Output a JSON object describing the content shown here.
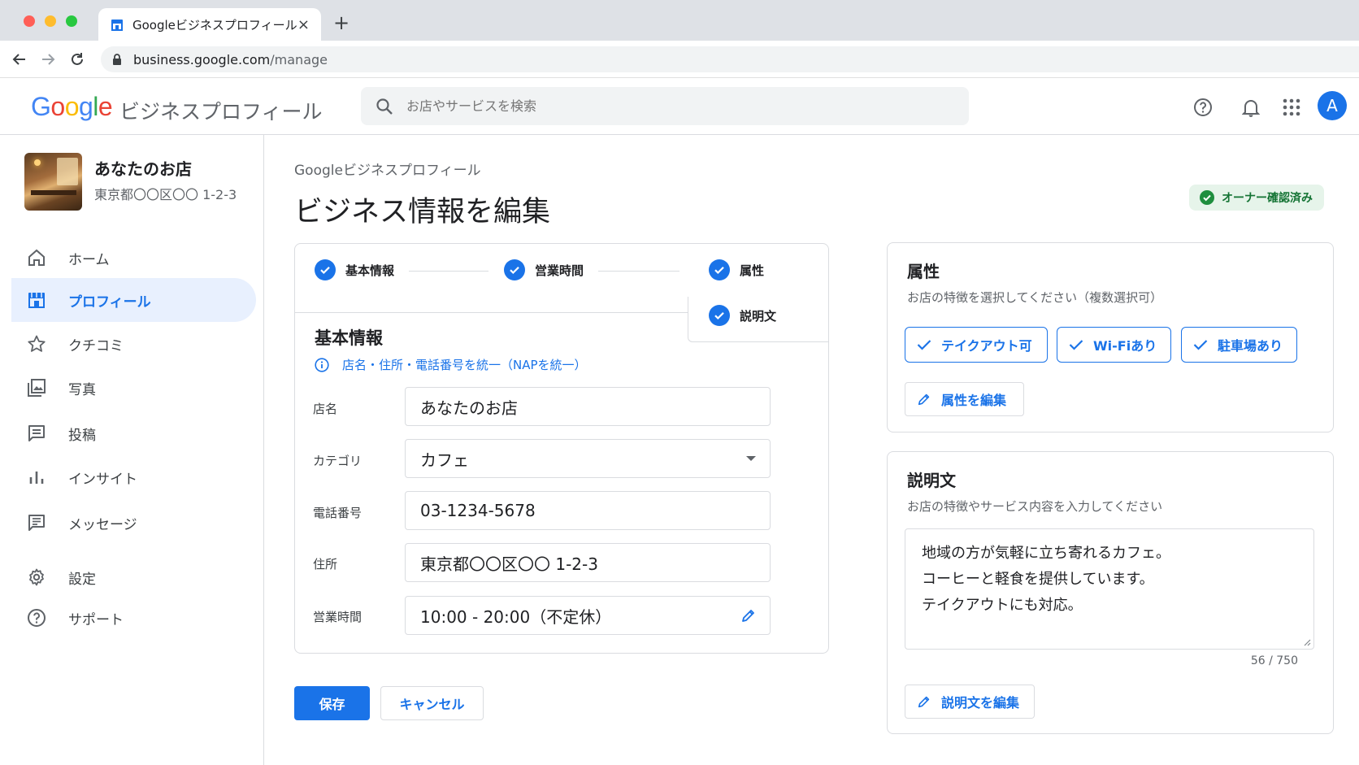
{
  "browser": {
    "tab_title": "Googleビジネスプロフィール",
    "tab_close": "×",
    "new_tab": "+",
    "url_host": "business.google.com",
    "url_path": "/manage"
  },
  "header": {
    "logo": [
      "G",
      "o",
      "o",
      "g",
      "l",
      "e"
    ],
    "product_name": "ビジネスプロフィール",
    "search_placeholder": "お店やサービスを検索",
    "avatar_letter": "A"
  },
  "sidebar": {
    "business_name": "あなたのお店",
    "business_address": "東京都〇〇区〇〇 1-2-3",
    "items": [
      {
        "label": "ホーム",
        "icon": "home-icon"
      },
      {
        "label": "プロフィール",
        "icon": "storefront-icon",
        "active": true
      },
      {
        "label": "クチコミ",
        "icon": "star-icon"
      },
      {
        "label": "写真",
        "icon": "photo-icon"
      },
      {
        "label": "投稿",
        "icon": "post-icon"
      },
      {
        "label": "インサイト",
        "icon": "bar-chart-icon"
      },
      {
        "label": "メッセージ",
        "icon": "message-icon"
      },
      {
        "label": "設定",
        "icon": "gear-icon"
      },
      {
        "label": "サポート",
        "icon": "help-icon"
      }
    ]
  },
  "main": {
    "breadcrumb": "Googleビジネスプロフィール",
    "title": "ビジネス情報を編集",
    "verified_badge": "オーナー確認済み",
    "steps": [
      "基本情報",
      "営業時間",
      "属性",
      "説明文"
    ],
    "basic": {
      "title": "基本情報",
      "note": "店名・住所・電話番号を統一（NAPを統一）",
      "fields": [
        {
          "label": "店名",
          "value": "あなたのお店"
        },
        {
          "label": "カテゴリ",
          "value": "カフェ"
        },
        {
          "label": "電話番号",
          "value": "03-1234-5678"
        },
        {
          "label": "住所",
          "value": "東京都〇〇区〇〇 1-2-3"
        },
        {
          "label": "営業時間",
          "value": "10:00 - 20:00（不定休）"
        }
      ]
    },
    "save_label": "保存",
    "cancel_label": "キャンセル"
  },
  "attributes": {
    "title": "属性",
    "subtitle": "お店の特徴を選択してください（複数選択可）",
    "chips": [
      "テイクアウト可",
      "Wi-Fiあり",
      "駐車場あり"
    ],
    "edit_label": "属性を編集"
  },
  "description": {
    "title": "説明文",
    "subtitle": "お店の特徴やサービス内容を入力してください",
    "lines": [
      "地域の方が気軽に立ち寄れるカフェ。",
      "コーヒーと軽食を提供しています。",
      "テイクアウトにも対応。"
    ],
    "counter": "56 / 750",
    "edit_label": "説明文を編集"
  },
  "colors": {
    "accent": "#1a73e8",
    "verified_bg": "#e6f4ea",
    "verified_fg": "#137333"
  }
}
